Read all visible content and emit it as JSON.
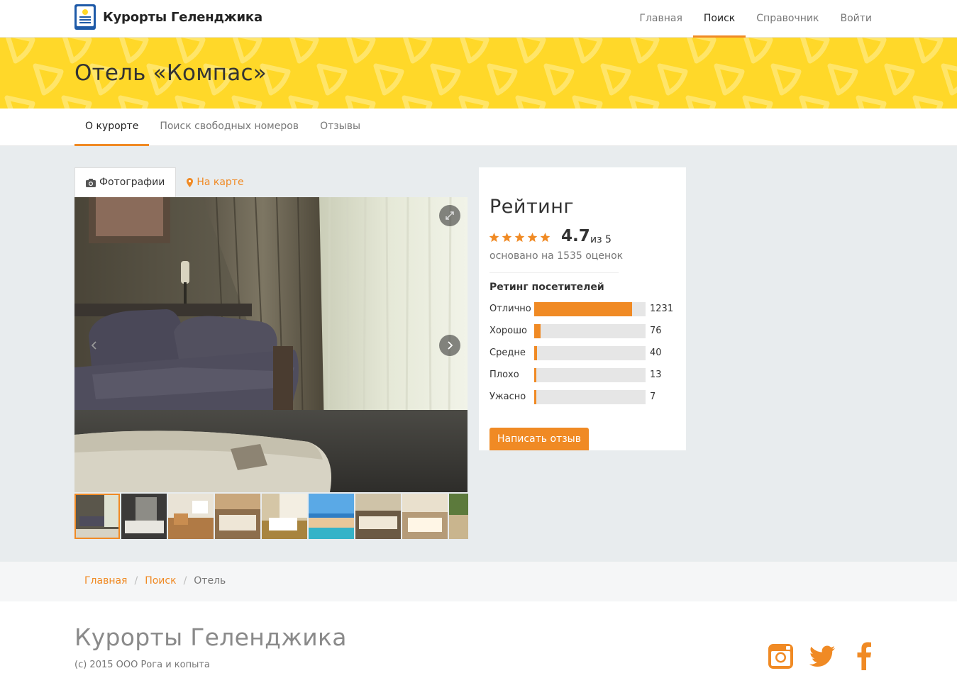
{
  "header": {
    "brand": "Курорты Геленджика",
    "nav": [
      {
        "label": "Главная",
        "active": false
      },
      {
        "label": "Поиск",
        "active": true
      },
      {
        "label": "Справочник",
        "active": false
      },
      {
        "label": "Войти",
        "active": false
      }
    ]
  },
  "banner": {
    "title": "Отель «Компас»"
  },
  "subnav": {
    "tabs": [
      {
        "label": "О курорте",
        "active": true
      },
      {
        "label": "Поиск свободных номеров",
        "active": false
      },
      {
        "label": "Отзывы",
        "active": false
      }
    ]
  },
  "gallery": {
    "tabs": [
      {
        "label": "Фотографии",
        "icon": "camera-icon",
        "active": true
      },
      {
        "label": "На карте",
        "icon": "map-marker-icon",
        "active": false
      }
    ],
    "thumb_count": 9,
    "active_thumb": 1
  },
  "rating": {
    "title": "Рейтинг",
    "stars_filled": 5,
    "score": "4.7",
    "out_of": "из 5",
    "based_on": "основано на 1535 оценок",
    "visitors_title": "Ретинг посетителей",
    "breakdown": [
      {
        "label": "Отлично",
        "count": "1231",
        "value": 1231
      },
      {
        "label": "Хорошо",
        "count": "76",
        "value": 76
      },
      {
        "label": "Средне",
        "count": "40",
        "value": 40
      },
      {
        "label": "Плохо",
        "count": "13",
        "value": 13
      },
      {
        "label": "Ужасно",
        "count": "7",
        "value": 7
      }
    ],
    "max_value": 1400,
    "write_review": "Написать отзыв"
  },
  "breadcrumb": {
    "items": [
      "Главная",
      "Поиск"
    ],
    "current": "Отель"
  },
  "footer": {
    "title": "Курорты Геленджика",
    "copyright": "(c) 2015 ООО Рога и копыта",
    "social": [
      "instagram-icon",
      "twitter-icon",
      "facebook-icon"
    ]
  },
  "colors": {
    "accent": "#f08a24",
    "banner": "#ffd829",
    "content_bg": "#e8ecee"
  }
}
